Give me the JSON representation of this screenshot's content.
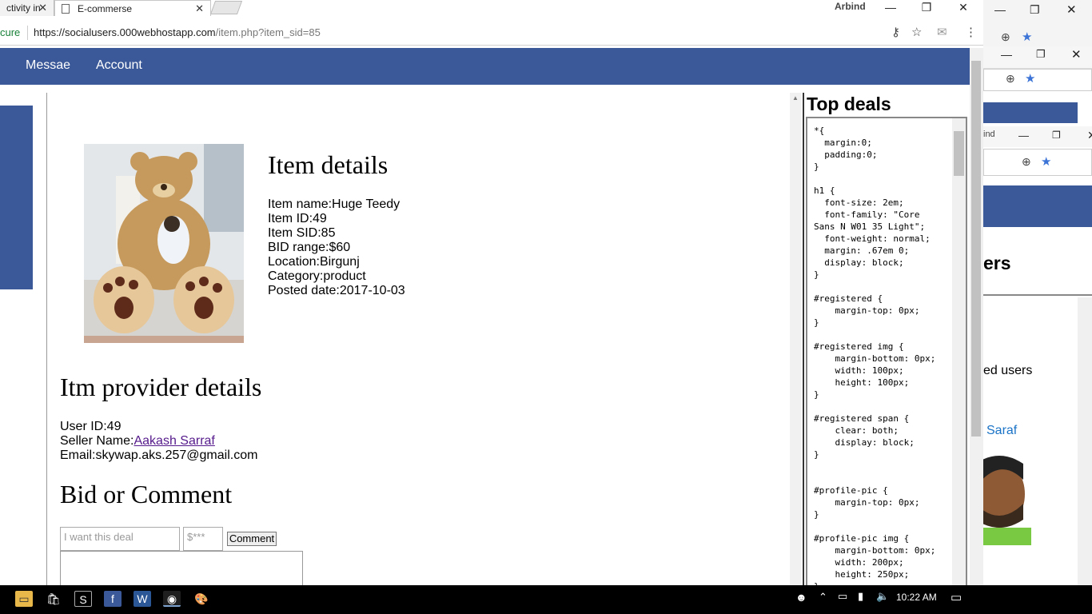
{
  "browser": {
    "tabs": [
      {
        "label": "ctivity in",
        "close": "✕"
      },
      {
        "label": "E-commerse",
        "close": "✕"
      }
    ],
    "user": "Arbind",
    "window_controls": {
      "minimize": "—",
      "maximize": "❐",
      "close": "✕"
    },
    "address": {
      "secure_label": "cure",
      "url_host": "https://socialusers.000webhostapp.com",
      "url_path": "/item.php?item_sid=85"
    }
  },
  "nav": {
    "links": [
      "Messae",
      "Account"
    ],
    "color": "#3b5998"
  },
  "item": {
    "heading": "Item details",
    "fields": [
      "Item name:Huge Teedy",
      "Item ID:49",
      "Item SID:85",
      "BID range:$60",
      "Location:Birgunj",
      "Category:product",
      "Posted date:2017-10-03"
    ]
  },
  "provider": {
    "heading": "Itm provider details",
    "user_id": "User ID:49",
    "seller_label": "Seller Name:",
    "seller_name": "Aakash Sarraf",
    "email": "Email:skywap.aks.257@gmail.com"
  },
  "bid": {
    "heading": "Bid or Comment",
    "comment_placeholder": "I want this deal",
    "price_placeholder": "$***",
    "button": "Comment"
  },
  "deals": {
    "title": "Top deals",
    "code": "*{\n  margin:0;\n  padding:0;\n}\n\nh1 {\n  font-size: 2em;\n  font-family: \"Core\nSans N W01 35 Light\";\n  font-weight: normal;\n  margin: .67em 0;\n  display: block;\n}\n\n#registered {\n    margin-top: 0px;\n}\n\n#registered img {\n    margin-bottom: 0px;\n    width: 100px;\n    height: 100px;\n}\n\n#registered span {\n    clear: both;\n    display: block;\n}\n\n\n#profile-pic {\n    margin-top: 0px;\n}\n\n#profile-pic img {\n    margin-bottom: 0px;\n    width: 200px;\n    height: 250px;\n}"
  },
  "bg_window": {
    "title_frag": "ind",
    "heading_frag": "ers",
    "text_frag": "ed users",
    "name_frag": "Saraf"
  },
  "taskbar": {
    "time": "10:22 AM"
  }
}
